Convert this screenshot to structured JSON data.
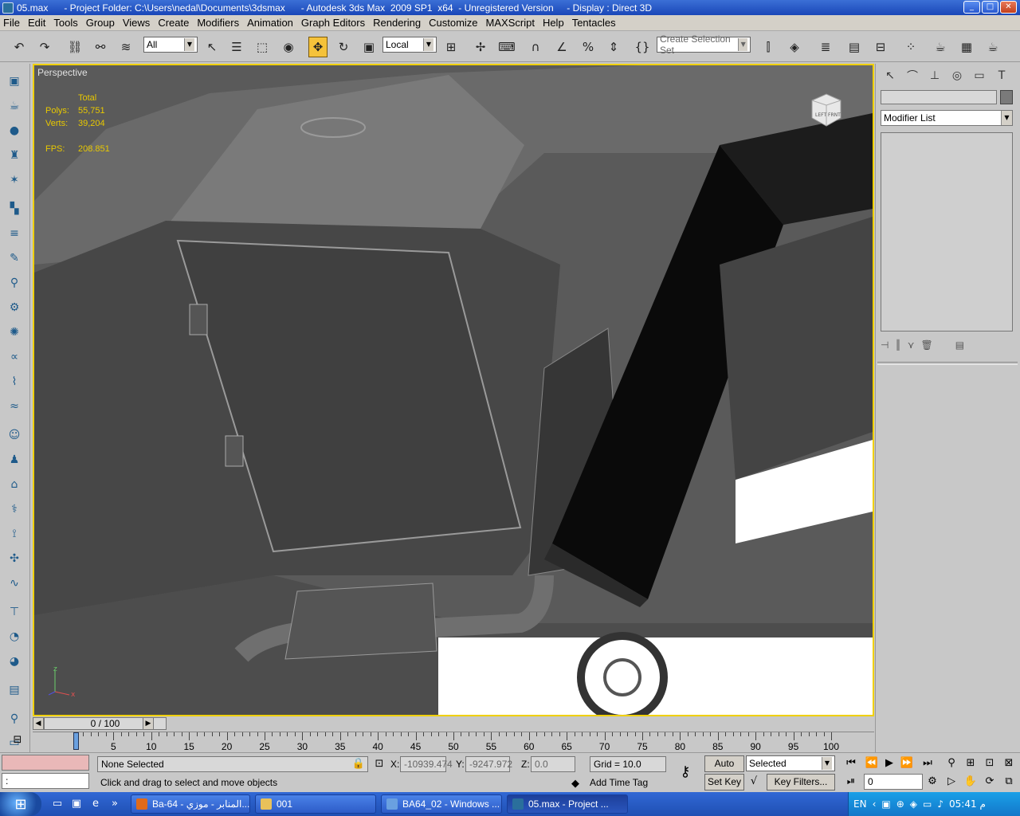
{
  "window": {
    "title": "05.max      - Project Folder: C:\\Users\\nedal\\Documents\\3dsmax      - Autodesk 3ds Max  2009 SP1  x64  - Unregistered Version     - Display : Direct 3D",
    "min": "_",
    "max": "□",
    "close": "✕"
  },
  "menu": [
    "File",
    "Edit",
    "Tools",
    "Group",
    "Views",
    "Create",
    "Modifiers",
    "Animation",
    "Graph Editors",
    "Rendering",
    "Customize",
    "MAXScript",
    "Help",
    "Tentacles"
  ],
  "toolbar": {
    "filter_value": "All",
    "coord_value": "Local",
    "selection_set_placeholder": "Create Selection Set",
    "icons": [
      "undo-icon",
      "redo-icon",
      "select-and-link-icon",
      "unlink-icon",
      "bind-space-warp-icon",
      "select-object-icon",
      "select-by-name-icon",
      "rect-region-icon",
      "window-crossing-icon",
      "move-icon",
      "rotate-icon",
      "scale-icon",
      "pivot-icon",
      "manipulate-icon",
      "keyboard-shortcut-icon",
      "snap-icon",
      "angle-snap-icon",
      "percent-snap-icon",
      "spinner-snap-icon",
      "edit-named-sets-icon",
      "mirror-icon",
      "align-icon",
      "layer-manager-icon",
      "curve-editor-icon",
      "schematic-view-icon",
      "material-editor-icon",
      "render-setup-icon",
      "rendered-frame-icon",
      "quick-render-icon"
    ]
  },
  "viewport": {
    "label": "Perspective",
    "stats_header": "Total",
    "polys_label": "Polys:",
    "polys_value": "55,751",
    "verts_label": "Verts:",
    "verts_value": "39,204",
    "fps_label": "FPS:",
    "fps_value": "208.851",
    "viewcube_left": "LEFT",
    "viewcube_front": "FRNT",
    "axis_x": "x",
    "axis_z": "z"
  },
  "command_panel": {
    "modifier_list": "Modifier List",
    "tabs": [
      "create-tab-icon",
      "modify-tab-icon",
      "hierarchy-tab-icon",
      "motion-tab-icon",
      "display-tab-icon",
      "utilities-tab-icon"
    ]
  },
  "timeline": {
    "frame": "0 / 100",
    "ticks": [
      0,
      5,
      10,
      15,
      20,
      25,
      30,
      35,
      40,
      45,
      50,
      55,
      60,
      65,
      70,
      75,
      80,
      85,
      90,
      95,
      100
    ]
  },
  "status": {
    "selection": "None Selected",
    "prompt": "Click and drag to select and move objects",
    "maxscript": ":",
    "x_label": "X:",
    "x_value": "-10939.474",
    "y_label": "Y:",
    "y_value": "-9247.972",
    "z_label": "Z:",
    "z_value": "0.0",
    "grid": "Grid = 10.0",
    "add_time_tag": "Add Time Tag",
    "auto_key": "Auto Key",
    "set_key": "Set Key",
    "key_mode": "Selected",
    "key_filters": "Key Filters...",
    "current_frame": "0"
  },
  "taskbar": {
    "tasks": [
      "Ba-64 - المنابر - موزي...",
      "001",
      "BA64_02 - Windows ...",
      "05.max     - Project ..."
    ],
    "lang": "EN",
    "time": "05:41 م"
  },
  "colors": {
    "title_bar": "#1a47b8",
    "viewport_border": "#f0d000",
    "stats_text": "#e8c800",
    "move_active": "#f5c23a"
  }
}
